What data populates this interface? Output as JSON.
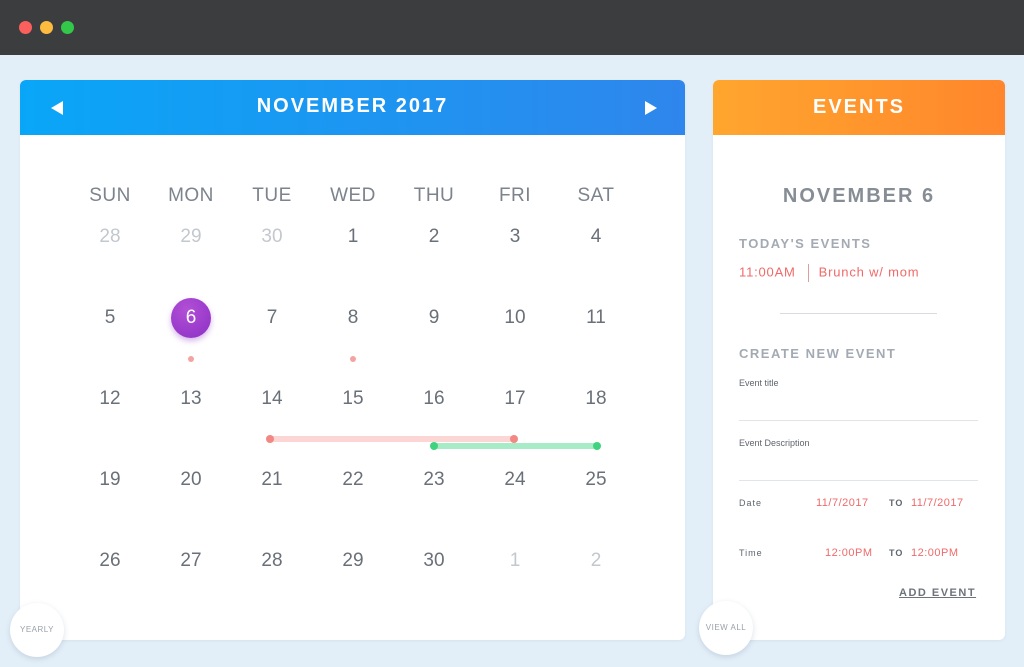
{
  "window": {
    "controls": [
      "close",
      "minimize",
      "maximize"
    ],
    "colors": {
      "close": "#fc605c",
      "minimize": "#fdbc40",
      "maximize": "#34c84a"
    }
  },
  "calendar": {
    "month_title": "NOVEMBER 2017",
    "prev_icon": "triangle-left-icon",
    "next_icon": "triangle-right-icon",
    "accent": "#2f86ec",
    "weekdays": [
      "SUN",
      "MON",
      "TUE",
      "WED",
      "THU",
      "FRI",
      "SAT"
    ],
    "weeks": [
      [
        {
          "d": "28",
          "m": true
        },
        {
          "d": "29",
          "m": true
        },
        {
          "d": "30",
          "m": true
        },
        {
          "d": "1"
        },
        {
          "d": "2"
        },
        {
          "d": "3"
        },
        {
          "d": "4"
        }
      ],
      [
        {
          "d": "5"
        },
        {
          "d": "6",
          "sel": true,
          "dot": true
        },
        {
          "d": "7"
        },
        {
          "d": "8",
          "dot": true
        },
        {
          "d": "9"
        },
        {
          "d": "10"
        },
        {
          "d": "11"
        }
      ],
      [
        {
          "d": "12"
        },
        {
          "d": "13"
        },
        {
          "d": "14"
        },
        {
          "d": "15"
        },
        {
          "d": "16"
        },
        {
          "d": "17"
        },
        {
          "d": "18"
        }
      ],
      [
        {
          "d": "19"
        },
        {
          "d": "20"
        },
        {
          "d": "21"
        },
        {
          "d": "22"
        },
        {
          "d": "23"
        },
        {
          "d": "24"
        },
        {
          "d": "25"
        }
      ],
      [
        {
          "d": "26"
        },
        {
          "d": "27"
        },
        {
          "d": "28"
        },
        {
          "d": "29"
        },
        {
          "d": "30"
        },
        {
          "d": "1",
          "m": true
        },
        {
          "d": "2",
          "m": true
        }
      ]
    ],
    "selected_color": "#9b3bd0",
    "event_dot_color": "#f4a3a0",
    "ranges": [
      {
        "color": "red",
        "from_day": "14",
        "to_day": "17"
      },
      {
        "color": "green",
        "from_day": "16",
        "to_day": "18"
      }
    ],
    "yearly_label": "YEARLY"
  },
  "events": {
    "title": "EVENTS",
    "accent": "#ff862c",
    "selected_date": "NOVEMBER 6",
    "today_label": "TODAY'S EVENTS",
    "today_items": [
      {
        "time": "11:00AM",
        "name": "Brunch w/ mom"
      }
    ],
    "create_label": "CREATE NEW EVENT",
    "title_field": {
      "label": "Event title",
      "value": ""
    },
    "desc_field": {
      "label": "Event Description",
      "value": ""
    },
    "date_row": {
      "label": "Date",
      "from": "11/7/2017",
      "to_word": "TO",
      "to": "11/7/2017"
    },
    "time_row": {
      "label": "Time",
      "from": "12:00PM",
      "to_word": "TO",
      "to": "12:00PM"
    },
    "add_label": "ADD EVENT",
    "view_all_label": "VIEW ALL"
  }
}
